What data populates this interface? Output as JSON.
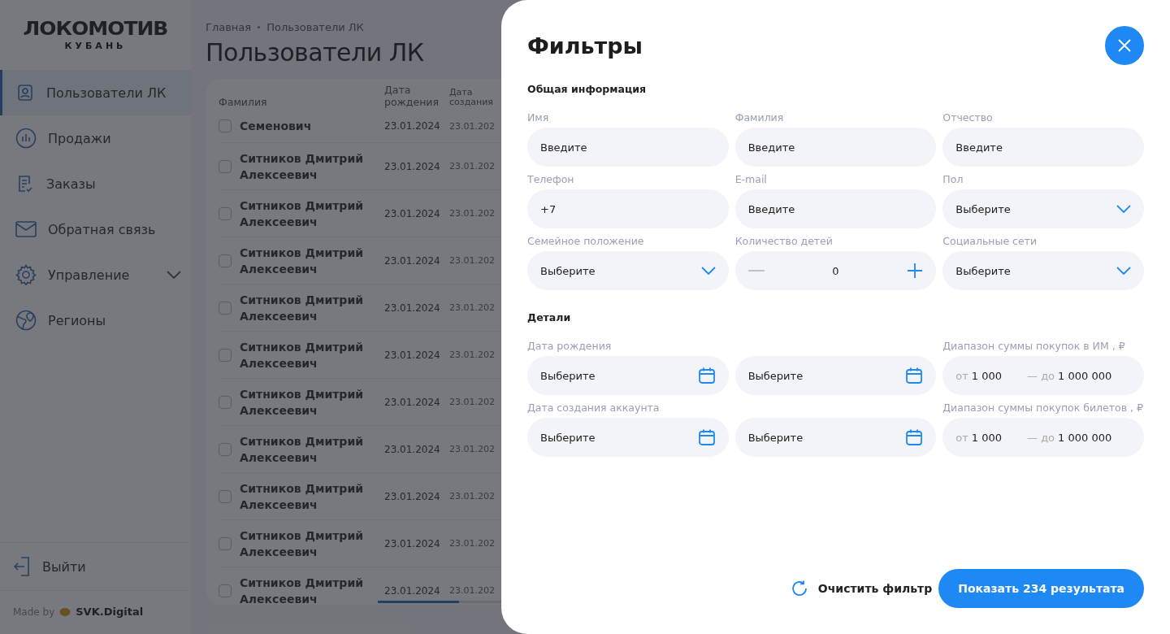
{
  "sidebar": {
    "logo": {
      "title": "ЛОКОМОТИВ",
      "subtitle": "КУБАНЬ"
    },
    "items": [
      {
        "label": "Пользователи ЛК",
        "selected": true,
        "expandable": false
      },
      {
        "label": "Продажи",
        "selected": false,
        "expandable": false
      },
      {
        "label": "Заказы",
        "selected": false,
        "expandable": false
      },
      {
        "label": "Обратная связь",
        "selected": false,
        "expandable": false
      },
      {
        "label": "Управление",
        "selected": false,
        "expandable": true
      },
      {
        "label": "Регионы",
        "selected": false,
        "expandable": false
      }
    ],
    "logout": "Выйти",
    "made_by": "Made by",
    "brand": "SVK.Digital"
  },
  "breadcrumbs": [
    "Главная",
    "Пользователи ЛК"
  ],
  "page_title": "Пользователи ЛК",
  "table": {
    "columns": [
      "Фамилия",
      "Дата рождения",
      "Дата создания"
    ],
    "rows": [
      {
        "checked": false,
        "cells": [
          "Семенович",
          "23.01.2024",
          "23.01.202"
        ]
      },
      {
        "checked": false,
        "cells": [
          "Ситников Дмитрий Алексеевич",
          "23.01.2024",
          "23.01.202"
        ]
      },
      {
        "checked": false,
        "cells": [
          "Ситников Дмитрий Алексеевич",
          "23.01.2024",
          "23.01.202"
        ]
      },
      {
        "checked": false,
        "cells": [
          "Ситников Дмитрий Алексеевич",
          "23.01.2024",
          "23.01.202"
        ]
      },
      {
        "checked": false,
        "cells": [
          "Ситников Дмитрий Алексеевич",
          "23.01.2024",
          "23.01.202"
        ]
      },
      {
        "checked": false,
        "cells": [
          "Ситников Дмитрий Алексеевич",
          "23.01.2024",
          "23.01.202"
        ]
      },
      {
        "checked": false,
        "cells": [
          "Ситников Дмитрий Алексеевич",
          "23.01.2024",
          "23.01.202"
        ]
      },
      {
        "checked": false,
        "cells": [
          "Ситников Дмитрий Алексеевич",
          "23.01.2024",
          "23.01.202"
        ]
      },
      {
        "checked": false,
        "cells": [
          "Ситников Дмитрий Алексеевич",
          "23.01.2024",
          "23.01.202"
        ]
      },
      {
        "checked": false,
        "cells": [
          "Ситников Дмитрий Алексеевич",
          "23.01.2024",
          "23.01.202"
        ]
      },
      {
        "checked": false,
        "cells": [
          "Ситников Дмитрий Алексеевич",
          "23.01.2024",
          "23.01.202"
        ]
      }
    ]
  },
  "filters": {
    "title": "Фильтры",
    "sections": [
      {
        "title": "Общая информация",
        "fields": [
          {
            "kind": "text",
            "label": "Имя",
            "placeholder": "Введите"
          },
          {
            "kind": "text",
            "label": "Фамилия",
            "placeholder": "Введите"
          },
          {
            "kind": "text",
            "label": "Отчество",
            "placeholder": "Введите"
          },
          {
            "kind": "text",
            "label": "Телефон",
            "value": "+7"
          },
          {
            "kind": "text",
            "label": "E-mail",
            "placeholder": "Введите"
          },
          {
            "kind": "select",
            "label": "Пол",
            "placeholder": "Выберите"
          },
          {
            "kind": "select",
            "label": "Семейное положение",
            "placeholder": "Выберите"
          },
          {
            "kind": "stepper",
            "label": "Количество детей",
            "value": "0"
          },
          {
            "kind": "select",
            "label": "Социальные сети",
            "placeholder": "Выберите"
          }
        ]
      },
      {
        "title": "Детали",
        "fields": [
          {
            "kind": "date",
            "label": "Дата рождения",
            "placeholder": "Выберите"
          },
          {
            "kind": "date",
            "placeholder": "Выберите"
          },
          {
            "kind": "range",
            "label": "Диапазон суммы покупок в ИМ , ₽",
            "from_label": "от",
            "from": "1 000",
            "to_label": "— до",
            "to": "1 000 000"
          },
          {
            "kind": "date",
            "label": "Дата создания аккаунта",
            "placeholder": "Выберите"
          },
          {
            "kind": "date",
            "placeholder": "Выберите"
          },
          {
            "kind": "range",
            "label": "Диапазон суммы покупок билетов , ₽",
            "from_label": "от",
            "from": "1 000",
            "to_label": "— до",
            "to": "1 000 000"
          }
        ]
      }
    ],
    "reset": "Очистить фильтр",
    "submit": "Показать 234 результата"
  }
}
